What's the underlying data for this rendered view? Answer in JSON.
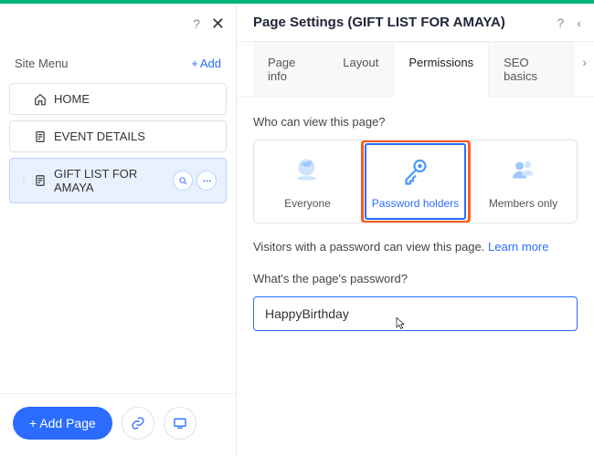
{
  "sidebar": {
    "title": "Site Menu",
    "add_label": "Add",
    "items": [
      {
        "label": "HOME",
        "icon": "home-icon"
      },
      {
        "label": "EVENT DETAILS",
        "icon": "page-icon"
      },
      {
        "label": "GIFT LIST FOR AMAYA",
        "icon": "page-icon"
      }
    ],
    "add_page_label": "+ Add Page"
  },
  "left_header": {
    "help": "?",
    "close": "✕"
  },
  "settings": {
    "title": "Page Settings (GIFT LIST FOR AMAYA)",
    "help": "?",
    "back": "‹",
    "tabs": {
      "info": "Page info",
      "layout": "Layout",
      "permissions": "Permissions",
      "seo": "SEO basics",
      "more": "›"
    },
    "permissions": {
      "who_label": "Who can view this page?",
      "options": {
        "everyone": "Everyone",
        "password": "Password holders",
        "members": "Members only"
      },
      "helper_prefix": "Visitors with a password can view this page. ",
      "helper_link": "Learn more",
      "password_label": "What's the page's password?",
      "password_value": "HappyBirthday"
    }
  }
}
